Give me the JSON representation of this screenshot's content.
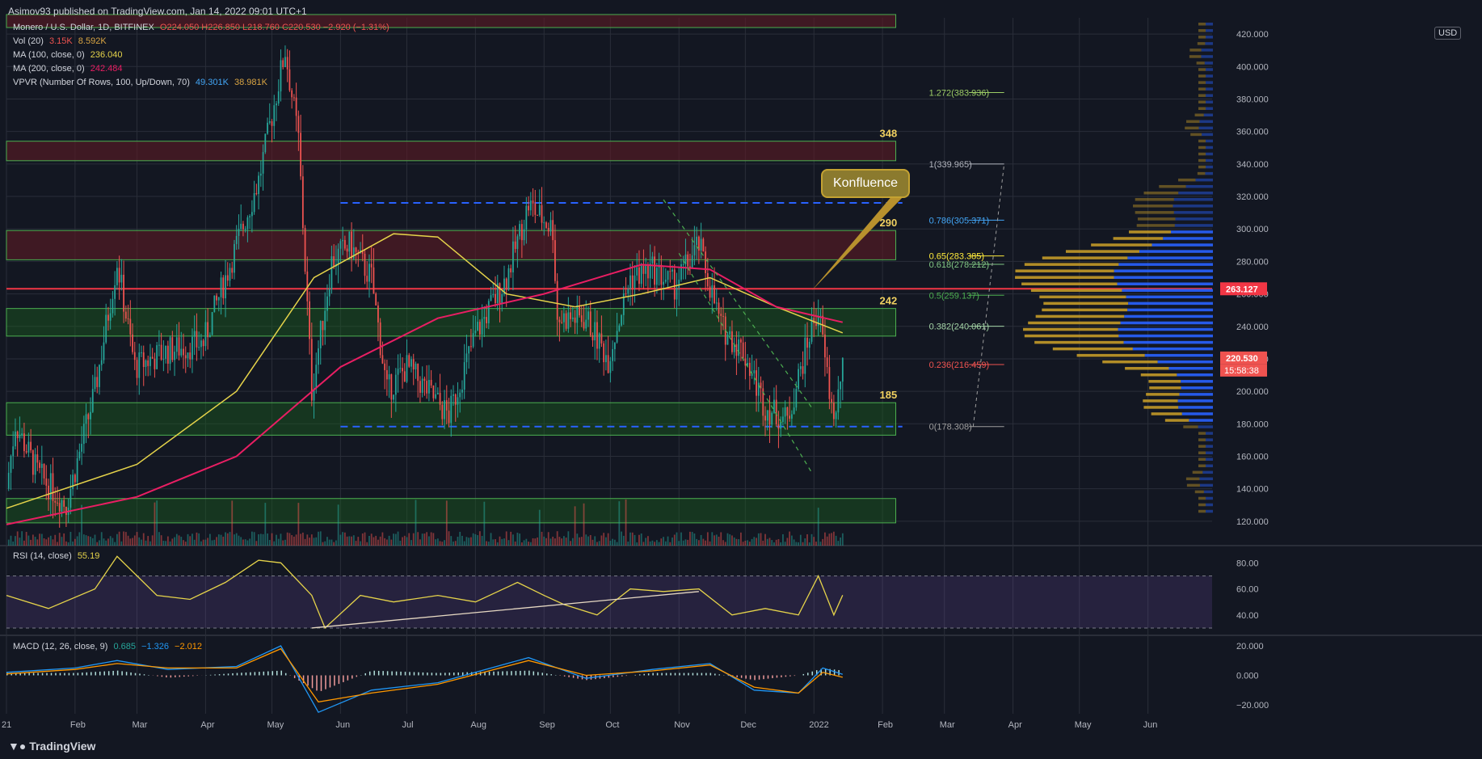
{
  "header": {
    "published": "Asimov93 published on TradingView.com, Jan 14, 2022 09:01 UTC+1",
    "symbol": "Monero / U.S. Dollar, 1D, BITFINEX",
    "ohlc": "O224.050  H226.850  L218.760  C220.530  −2.920 (−1.31%)",
    "vol": {
      "label": "Vol (20)",
      "v1": "3.15K",
      "v2": "8.592K"
    },
    "ma100": {
      "label": "MA (100, close, 0)",
      "value": "236.040"
    },
    "ma200": {
      "label": "MA (200, close, 0)",
      "value": "242.484"
    },
    "vpvr": {
      "label": "VPVR (Number Of Rows, 100, Up/Down, 70)",
      "up": "49.301K",
      "down": "38.981K"
    }
  },
  "currency": "USD",
  "footer": {
    "logo": "TradingView"
  },
  "colors": {
    "bg": "#131722",
    "grid": "#2a2e39",
    "up": "#26a69a",
    "down": "#ef5350",
    "ma100": "#e5d34a",
    "ma200": "#e91e63",
    "zone_green": "#1b5e20",
    "zone_red": "#5d1a24",
    "fib_green": "#4caf50",
    "accent_red": "#f23645",
    "vp_blue": "#2962ff",
    "vp_gold": "#c49a28"
  },
  "chart_data": [
    {
      "type": "candlestick",
      "title": "Monero / U.S. Dollar, 1D, BITFINEX",
      "x_ticks": [
        "21",
        "Feb",
        "Mar",
        "Apr",
        "May",
        "Jun",
        "Jul",
        "Aug",
        "Sep",
        "Oct",
        "Nov",
        "Dec",
        "2022",
        "Feb",
        "Mar",
        "Apr",
        "May",
        "Jun"
      ],
      "y_ticks": [
        120,
        140,
        160,
        180,
        200,
        220,
        240,
        260,
        280,
        300,
        320,
        340,
        360,
        380,
        400,
        420
      ],
      "ylim": [
        105,
        430
      ],
      "price_path": [
        {
          "x": "2021-01-01",
          "y": 140
        },
        {
          "x": "2021-01-05",
          "y": 180
        },
        {
          "x": "2021-01-15",
          "y": 150
        },
        {
          "x": "2021-01-28",
          "y": 130
        },
        {
          "x": "2021-02-10",
          "y": 200
        },
        {
          "x": "2021-02-20",
          "y": 280
        },
        {
          "x": "2021-02-28",
          "y": 215
        },
        {
          "x": "2021-03-15",
          "y": 225
        },
        {
          "x": "2021-03-31",
          "y": 230
        },
        {
          "x": "2021-04-15",
          "y": 290
        },
        {
          "x": "2021-04-25",
          "y": 330
        },
        {
          "x": "2021-05-07",
          "y": 410
        },
        {
          "x": "2021-05-13",
          "y": 355
        },
        {
          "x": "2021-05-19",
          "y": 200
        },
        {
          "x": "2021-05-28",
          "y": 280
        },
        {
          "x": "2021-06-05",
          "y": 290
        },
        {
          "x": "2021-06-15",
          "y": 270
        },
        {
          "x": "2021-06-22",
          "y": 200
        },
        {
          "x": "2021-07-01",
          "y": 215
        },
        {
          "x": "2021-07-20",
          "y": 185
        },
        {
          "x": "2021-08-01",
          "y": 235
        },
        {
          "x": "2021-08-15",
          "y": 270
        },
        {
          "x": "2021-08-25",
          "y": 315
        },
        {
          "x": "2021-09-05",
          "y": 300
        },
        {
          "x": "2021-09-07",
          "y": 245
        },
        {
          "x": "2021-09-20",
          "y": 245
        },
        {
          "x": "2021-09-30",
          "y": 220
        },
        {
          "x": "2021-10-10",
          "y": 270
        },
        {
          "x": "2021-10-20",
          "y": 275
        },
        {
          "x": "2021-10-30",
          "y": 265
        },
        {
          "x": "2021-11-10",
          "y": 290
        },
        {
          "x": "2021-11-20",
          "y": 240
        },
        {
          "x": "2021-11-30",
          "y": 225
        },
        {
          "x": "2021-12-10",
          "y": 190
        },
        {
          "x": "2021-12-20",
          "y": 182
        },
        {
          "x": "2021-12-31",
          "y": 240
        },
        {
          "x": "2022-01-03",
          "y": 250
        },
        {
          "x": "2022-01-09",
          "y": 190
        },
        {
          "x": "2022-01-11",
          "y": 185
        },
        {
          "x": "2022-01-14",
          "y": 220.53
        }
      ],
      "ma100_path": [
        {
          "x": "2021-01-01",
          "y": 128
        },
        {
          "x": "2021-03-01",
          "y": 155
        },
        {
          "x": "2021-04-15",
          "y": 200
        },
        {
          "x": "2021-05-20",
          "y": 270
        },
        {
          "x": "2021-06-25",
          "y": 297
        },
        {
          "x": "2021-07-15",
          "y": 295
        },
        {
          "x": "2021-08-15",
          "y": 260
        },
        {
          "x": "2021-09-15",
          "y": 252
        },
        {
          "x": "2021-10-15",
          "y": 260
        },
        {
          "x": "2021-11-15",
          "y": 270
        },
        {
          "x": "2021-12-15",
          "y": 252
        },
        {
          "x": "2022-01-14",
          "y": 236
        }
      ],
      "ma200_path": [
        {
          "x": "2021-01-01",
          "y": 118
        },
        {
          "x": "2021-03-01",
          "y": 135
        },
        {
          "x": "2021-04-15",
          "y": 160
        },
        {
          "x": "2021-06-01",
          "y": 215
        },
        {
          "x": "2021-07-15",
          "y": 245
        },
        {
          "x": "2021-09-01",
          "y": 260
        },
        {
          "x": "2021-10-15",
          "y": 278
        },
        {
          "x": "2021-11-15",
          "y": 275
        },
        {
          "x": "2021-12-15",
          "y": 252
        },
        {
          "x": "2022-01-14",
          "y": 242.5
        }
      ],
      "zones": [
        {
          "kind": "resistance",
          "from": 342,
          "to": 354,
          "label": "348"
        },
        {
          "kind": "resistance",
          "from": 281,
          "to": 299,
          "label": "290"
        },
        {
          "kind": "support",
          "from": 234,
          "to": 251,
          "label": "242"
        },
        {
          "kind": "support",
          "from": 173,
          "to": 193,
          "label": "185"
        },
        {
          "kind": "support",
          "from": 119,
          "to": 134,
          "label": ""
        },
        {
          "kind": "resistance",
          "from": 424,
          "to": 432,
          "label": ""
        }
      ],
      "fib_levels": [
        {
          "ratio": "1.272",
          "price": "383.936",
          "value": 383.936,
          "color": "#9ccc65"
        },
        {
          "ratio": "1",
          "price": "339.965",
          "value": 339.965,
          "color": "#b2b5be"
        },
        {
          "ratio": "0.786",
          "price": "305.371",
          "value": 305.371,
          "color": "#42a5f5"
        },
        {
          "ratio": "0.65",
          "price": "283.385",
          "value": 283.385,
          "color": "#ffeb3b"
        },
        {
          "ratio": "0.618",
          "price": "278.212",
          "value": 278.212,
          "color": "#81c784"
        },
        {
          "ratio": "0.5",
          "price": "259.137",
          "value": 259.137,
          "color": "#4caf50"
        },
        {
          "ratio": "0.382",
          "price": "240.061",
          "value": 240.061,
          "color": "#a5d6a7"
        },
        {
          "ratio": "0.236",
          "price": "216.459",
          "value": 216.459,
          "color": "#ef5350"
        },
        {
          "ratio": "0",
          "price": "178.308",
          "value": 178.308,
          "color": "#9e9e9e"
        }
      ],
      "horizontal_lines": [
        {
          "price": 316,
          "style": "dashed-blue"
        },
        {
          "price": 178.3,
          "style": "dashed-blue"
        },
        {
          "price": 263.127,
          "style": "solid-red"
        }
      ],
      "price_labels": [
        {
          "text": "263.127",
          "price": 263.127,
          "color": "#f23645"
        },
        {
          "text": "220.530",
          "price": 220.53,
          "color": "#ef5350"
        }
      ],
      "countdown": "15:58:38",
      "annotation": "Konfluence"
    },
    {
      "type": "line",
      "title": "RSI (14, close)",
      "current": "55.19",
      "y_ticks": [
        40,
        60,
        80
      ],
      "ylim": [
        25,
        92
      ],
      "band": [
        30,
        70
      ],
      "series": [
        {
          "x": [
            "2021-01-01",
            "2021-01-20",
            "2021-02-10",
            "2021-02-20",
            "2021-03-10",
            "2021-03-25",
            "2021-04-10",
            "2021-04-25",
            "2021-05-05",
            "2021-05-19",
            "2021-05-25",
            "2021-06-10",
            "2021-06-25",
            "2021-07-15",
            "2021-08-01",
            "2021-08-20",
            "2021-09-01",
            "2021-09-10",
            "2021-09-25",
            "2021-10-10",
            "2021-10-25",
            "2021-11-10",
            "2021-11-25",
            "2021-12-10",
            "2021-12-25",
            "2022-01-03",
            "2022-01-10",
            "2022-01-14"
          ],
          "values": [
            55,
            45,
            60,
            85,
            55,
            52,
            65,
            82,
            80,
            55,
            30,
            55,
            50,
            55,
            50,
            65,
            55,
            48,
            40,
            60,
            58,
            60,
            40,
            45,
            40,
            70,
            40,
            55.19
          ]
        }
      ]
    },
    {
      "type": "line",
      "title": "MACD (12, 26, close, 9)",
      "values_text": [
        "0.685",
        "−1.326",
        "−2.012"
      ],
      "y_ticks": [
        "20.000",
        "0.000",
        "−20.000"
      ],
      "ylim": [
        -26,
        26
      ],
      "series": [
        {
          "x": [
            "2021-01-01",
            "2021-02-01",
            "2021-02-20",
            "2021-03-15",
            "2021-04-15",
            "2021-05-05",
            "2021-05-22",
            "2021-06-15",
            "2021-07-15",
            "2021-08-25",
            "2021-09-20",
            "2021-10-20",
            "2021-11-15",
            "2021-12-05",
            "2021-12-25",
            "2022-01-05",
            "2022-01-14"
          ],
          "values": [
            2,
            5,
            10,
            4,
            6,
            20,
            -25,
            -10,
            -5,
            12,
            -2,
            4,
            8,
            -10,
            -12,
            5,
            0.685
          ]
        },
        {
          "x": [
            "2021-01-01",
            "2021-02-01",
            "2021-02-20",
            "2021-03-15",
            "2021-04-15",
            "2021-05-05",
            "2021-05-22",
            "2021-06-15",
            "2021-07-15",
            "2021-08-25",
            "2021-09-20",
            "2021-10-20",
            "2021-11-15",
            "2021-12-05",
            "2021-12-25",
            "2022-01-05",
            "2022-01-14"
          ],
          "values": [
            1,
            4,
            8,
            5,
            5,
            18,
            -18,
            -12,
            -6,
            10,
            0,
            3,
            7,
            -8,
            -12,
            2,
            -1.326
          ]
        }
      ]
    }
  ]
}
